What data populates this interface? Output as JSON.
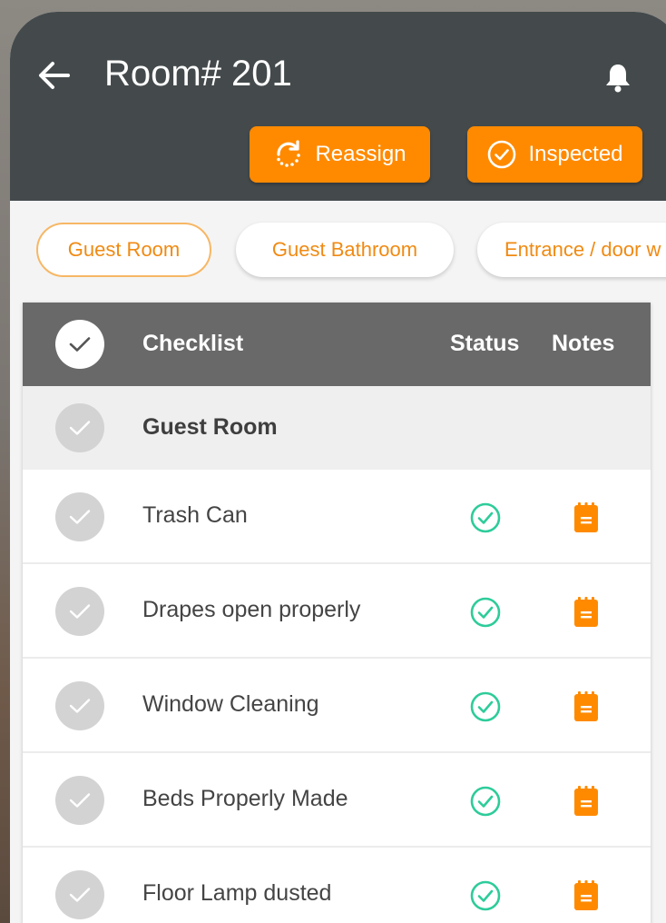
{
  "header": {
    "title": "Room# 201",
    "back_icon": "arrow-left-icon",
    "notification_icon": "bell-icon",
    "background_color": "#444a4c"
  },
  "actions": {
    "reassign_label": "Reassign",
    "inspected_label": "Inspected",
    "accent_color": "#ff8a00"
  },
  "tabs": [
    {
      "label": "Guest Room",
      "active": true
    },
    {
      "label": "Guest Bathroom",
      "active": false
    },
    {
      "label": "Entrance / door w",
      "active": false
    }
  ],
  "table": {
    "columns": {
      "checklist": "Checklist",
      "status": "Status",
      "notes": "Notes"
    },
    "section_title": "Guest Room",
    "items": [
      {
        "label": "Trash Can",
        "status": "ok"
      },
      {
        "label": "Drapes open properly",
        "status": "ok"
      },
      {
        "label": "Window Cleaning",
        "status": "ok"
      },
      {
        "label": "Beds Properly Made",
        "status": "ok"
      },
      {
        "label": "Floor Lamp dusted",
        "status": "ok"
      }
    ],
    "status_color": "#2ecc9a",
    "note_color": "#ff8a00"
  }
}
